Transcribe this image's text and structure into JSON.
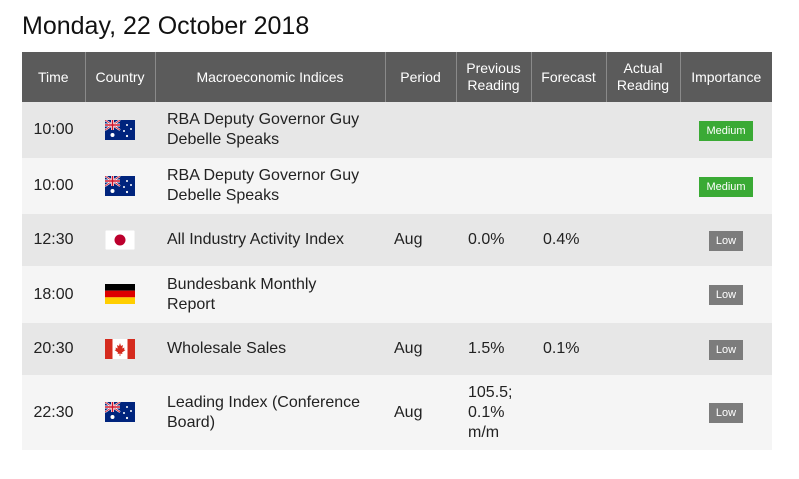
{
  "page": {
    "date_title": "Monday, 22 October 2018"
  },
  "table": {
    "headers": {
      "time": "Time",
      "country": "Country",
      "indices": "Macroeconomic Indices",
      "period": "Period",
      "previous_line1": "Previous",
      "previous_line2": "Reading",
      "forecast": "Forecast",
      "actual_line1": "Actual",
      "actual_line2": "Reading",
      "importance": "Importance"
    },
    "rows": [
      {
        "time": "10:00",
        "country": "australia-flag-icon",
        "event_line1": "RBA Deputy Governor Guy",
        "event_line2": "Debelle Speaks",
        "period": "",
        "previous_line1": "",
        "previous_line2": "",
        "previous_line3": "",
        "forecast": "",
        "actual": "",
        "importance": "Medium"
      },
      {
        "time": "10:00",
        "country": "australia-flag-icon",
        "event_line1": "RBA Deputy Governor Guy",
        "event_line2": "Debelle Speaks",
        "period": "",
        "previous_line1": "",
        "previous_line2": "",
        "previous_line3": "",
        "forecast": "",
        "actual": "",
        "importance": "Medium"
      },
      {
        "time": "12:30",
        "country": "japan-flag-icon",
        "event_line1": "All Industry Activity Index",
        "event_line2": "",
        "period": "Aug",
        "previous_line1": "0.0%",
        "previous_line2": "",
        "previous_line3": "",
        "forecast": "0.4%",
        "actual": "",
        "importance": "Low"
      },
      {
        "time": "18:00",
        "country": "germany-flag-icon",
        "event_line1": "Bundesbank Monthly",
        "event_line2": "Report",
        "period": "",
        "previous_line1": "",
        "previous_line2": "",
        "previous_line3": "",
        "forecast": "",
        "actual": "",
        "importance": "Low"
      },
      {
        "time": "20:30",
        "country": "canada-flag-icon",
        "event_line1": "Wholesale Sales",
        "event_line2": "",
        "period": "Aug",
        "previous_line1": "1.5%",
        "previous_line2": "",
        "previous_line3": "",
        "forecast": "0.1%",
        "actual": "",
        "importance": "Low"
      },
      {
        "time": "22:30",
        "country": "australia-flag-icon",
        "event_line1": "Leading Index (Conference",
        "event_line2": "Board)",
        "period": "Aug",
        "previous_line1": "105.5;",
        "previous_line2": "0.1%",
        "previous_line3": "m/m",
        "forecast": "",
        "actual": "",
        "importance": "Low"
      }
    ]
  },
  "colors": {
    "header_bg": "#5b5b5b",
    "row_odd": "#e7e7e7",
    "row_even": "#f5f5f5",
    "highlight_text": "#e8262a",
    "medium_badge": "#3aaa35",
    "low_badge": "#7c7c7c"
  }
}
